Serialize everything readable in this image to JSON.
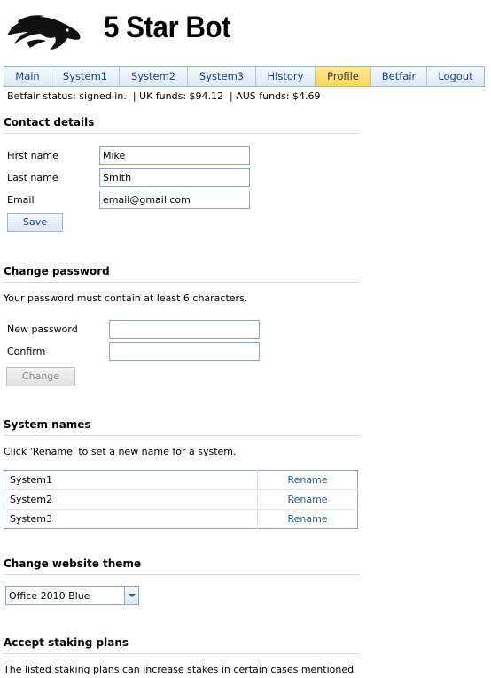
{
  "app": {
    "title": "5 Star Bot",
    "logo_icon": "horse-head-logo-icon"
  },
  "nav": {
    "tabs": [
      {
        "label": "Main",
        "active": false
      },
      {
        "label": "System1",
        "active": false
      },
      {
        "label": "System2",
        "active": false
      },
      {
        "label": "System3",
        "active": false
      },
      {
        "label": "History",
        "active": false
      },
      {
        "label": "Profile",
        "active": true
      },
      {
        "label": "Betfair",
        "active": false
      },
      {
        "label": "Logout",
        "active": false
      }
    ]
  },
  "status": {
    "text": "Betfair status: signed in.  | UK funds: $94.12  | AUS funds: $4.69"
  },
  "contact": {
    "title": "Contact details",
    "first_name_label": "First name",
    "first_name_value": "Mike",
    "last_name_label": "Last name",
    "last_name_value": "Smith",
    "email_label": "Email",
    "email_value": "email@gmail.com",
    "save_label": "Save"
  },
  "password": {
    "title": "Change password",
    "hint": "Your password must contain at least 6 characters.",
    "new_label": "New password",
    "confirm_label": "Confirm",
    "change_label": "Change"
  },
  "systems": {
    "title": "System names",
    "hint": "Click 'Rename' to set a new name for a system.",
    "rows": [
      {
        "name": "System1",
        "action": "Rename"
      },
      {
        "name": "System2",
        "action": "Rename"
      },
      {
        "name": "System3",
        "action": "Rename"
      }
    ]
  },
  "theme": {
    "title": "Change website theme",
    "selected": "Office 2010 Blue"
  },
  "staking": {
    "title": "Accept staking plans",
    "text": "The listed staking plans can increase stakes in certain cases mentioned"
  },
  "colors": {
    "accent": "#15428b",
    "active_tab": "#ffd55a",
    "link": "#1f5fa5"
  }
}
